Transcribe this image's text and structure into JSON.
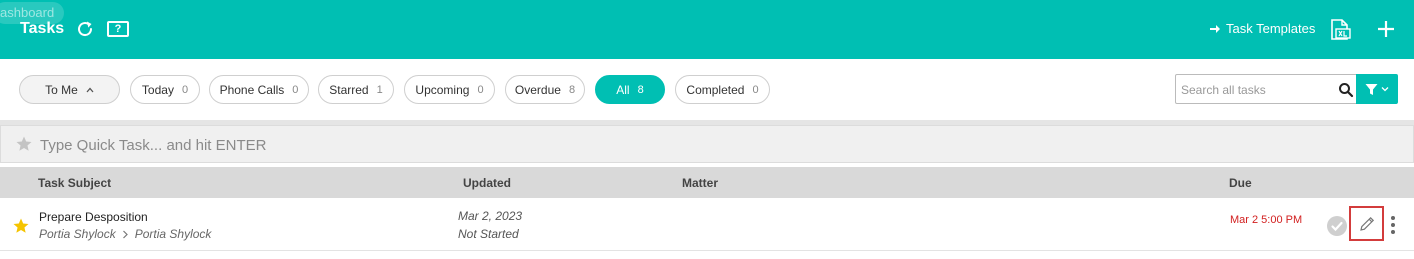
{
  "header": {
    "ghost_label": "ashboard",
    "title": "Tasks",
    "task_templates_label": "Task Templates",
    "help_label": "?"
  },
  "filters": {
    "to_me_label": "To Me",
    "items": [
      {
        "label": "Today",
        "count": "0"
      },
      {
        "label": "Phone Calls",
        "count": "0"
      },
      {
        "label": "Starred",
        "count": "1"
      },
      {
        "label": "Upcoming",
        "count": "0"
      },
      {
        "label": "Overdue",
        "count": "8"
      },
      {
        "label": "All",
        "count": "8"
      },
      {
        "label": "Completed",
        "count": "0"
      }
    ],
    "active": "All"
  },
  "search": {
    "placeholder": "Search all tasks",
    "value": ""
  },
  "quick_task": {
    "placeholder": "Type Quick Task... and hit ENTER"
  },
  "table": {
    "columns": [
      "Task Subject",
      "Updated",
      "Matter",
      "Due"
    ],
    "rows": [
      {
        "subject": "Prepare Desposition",
        "assigned_from": "Portia Shylock",
        "assigned_to": "Portia Shylock",
        "updated_date": "Mar 2, 2023",
        "status": "Not Started",
        "matter": "",
        "due": "Mar 2 5:00 PM",
        "starred": true
      }
    ]
  },
  "colors": {
    "accent": "#00bfb3",
    "due_overdue": "#d21f1f",
    "star": "#f5c400",
    "edit_highlight": "#d33c3c"
  },
  "icons": {
    "refresh": "refresh-icon",
    "help": "help-icon",
    "arrow": "arrow-right-icon",
    "export": "excel-export-icon",
    "add": "plus-icon",
    "search": "search-icon",
    "filter": "filter-icon",
    "star": "star-icon",
    "complete": "check-circle-icon",
    "edit": "pencil-icon",
    "more": "kebab-menu-icon"
  }
}
